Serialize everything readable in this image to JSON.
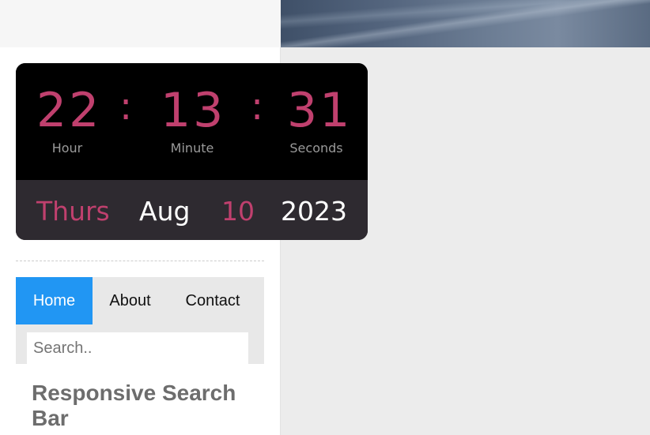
{
  "clock": {
    "hour": "22",
    "minute": "13",
    "seconds": "31",
    "separator": ":",
    "hour_label": "Hour",
    "minute_label": "Minute",
    "seconds_label": "Seconds",
    "day": "Thurs",
    "month": "Aug",
    "date": "10",
    "year": "2023"
  },
  "nav": {
    "items": [
      {
        "label": "Home",
        "active": true
      },
      {
        "label": "About",
        "active": false
      },
      {
        "label": "Contact",
        "active": false
      }
    ],
    "search_placeholder": "Search.."
  },
  "content": {
    "heading": "Responsive Search Bar"
  },
  "colors": {
    "clock_accent": "#c0406e",
    "nav_active": "#2196f3"
  }
}
